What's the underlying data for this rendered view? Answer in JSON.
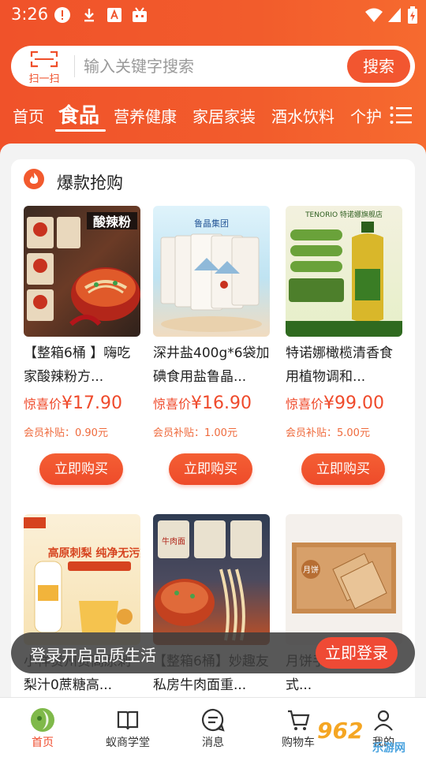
{
  "status_bar": {
    "time": "3:26"
  },
  "search": {
    "scan_label": "扫一扫",
    "placeholder": "输入关键字搜索",
    "button": "搜索"
  },
  "tabs": [
    {
      "label": "首页",
      "active": false
    },
    {
      "label": "食品",
      "active": true
    },
    {
      "label": "营养健康",
      "active": false
    },
    {
      "label": "家居家装",
      "active": false
    },
    {
      "label": "酒水饮料",
      "active": false
    },
    {
      "label": "个护",
      "active": false
    }
  ],
  "section": {
    "title": "爆款抢购"
  },
  "products": [
    {
      "name": "【整箱6桶 】嗨吃家酸辣粉方...",
      "price_label": "惊喜价",
      "price": "¥17.90",
      "subsidy": "会员补贴：0.90元",
      "buy": "立即购买",
      "image_text": "酸辣粉"
    },
    {
      "name": "深井盐400g*6袋加碘食用盐鲁晶...",
      "price_label": "惊喜价",
      "price": "¥16.90",
      "subsidy": "会员补贴：1.00元",
      "buy": "立即购买",
      "image_text": "鲁晶集团"
    },
    {
      "name": "特诺娜橄榄清香食用植物调和...",
      "price_label": "惊喜价",
      "price": "¥99.00",
      "subsidy": "会员补贴：5.00元",
      "buy": "立即购买",
      "image_text": "TENORIO 特诺娜旗舰店"
    },
    {
      "name": "小样贵州贵高原刺梨汁0蔗糖高...",
      "price_label": "",
      "price": "",
      "subsidy": "",
      "buy": "",
      "image_text": "高原刺梨 纯净无污染"
    },
    {
      "name": "【整箱6桶】妙趣友私房牛肉面重...",
      "price_label": "",
      "price": "",
      "subsidy": "",
      "buy": "",
      "image_text": "牛肉面"
    },
    {
      "name": "月饼手工月饼老式...",
      "price_label": "",
      "price": "",
      "subsidy": "",
      "buy": "",
      "image_text": "月饼"
    }
  ],
  "toast": {
    "text": "登录开启品质生活",
    "button": "立即登录"
  },
  "bottom_nav": [
    {
      "label": "首页",
      "icon": "home-logo-icon",
      "active": true
    },
    {
      "label": "蚁商学堂",
      "icon": "book-icon",
      "active": false
    },
    {
      "label": "消息",
      "icon": "message-icon",
      "active": false
    },
    {
      "label": "购物车",
      "icon": "cart-icon",
      "active": false
    },
    {
      "label": "我的",
      "icon": "user-icon",
      "active": false
    }
  ],
  "watermark": {
    "text": "962",
    "sub": "乐游网"
  },
  "colors": {
    "accent": "#f25630",
    "price": "#ef4a2b",
    "toast_button": "#ef4a35"
  }
}
